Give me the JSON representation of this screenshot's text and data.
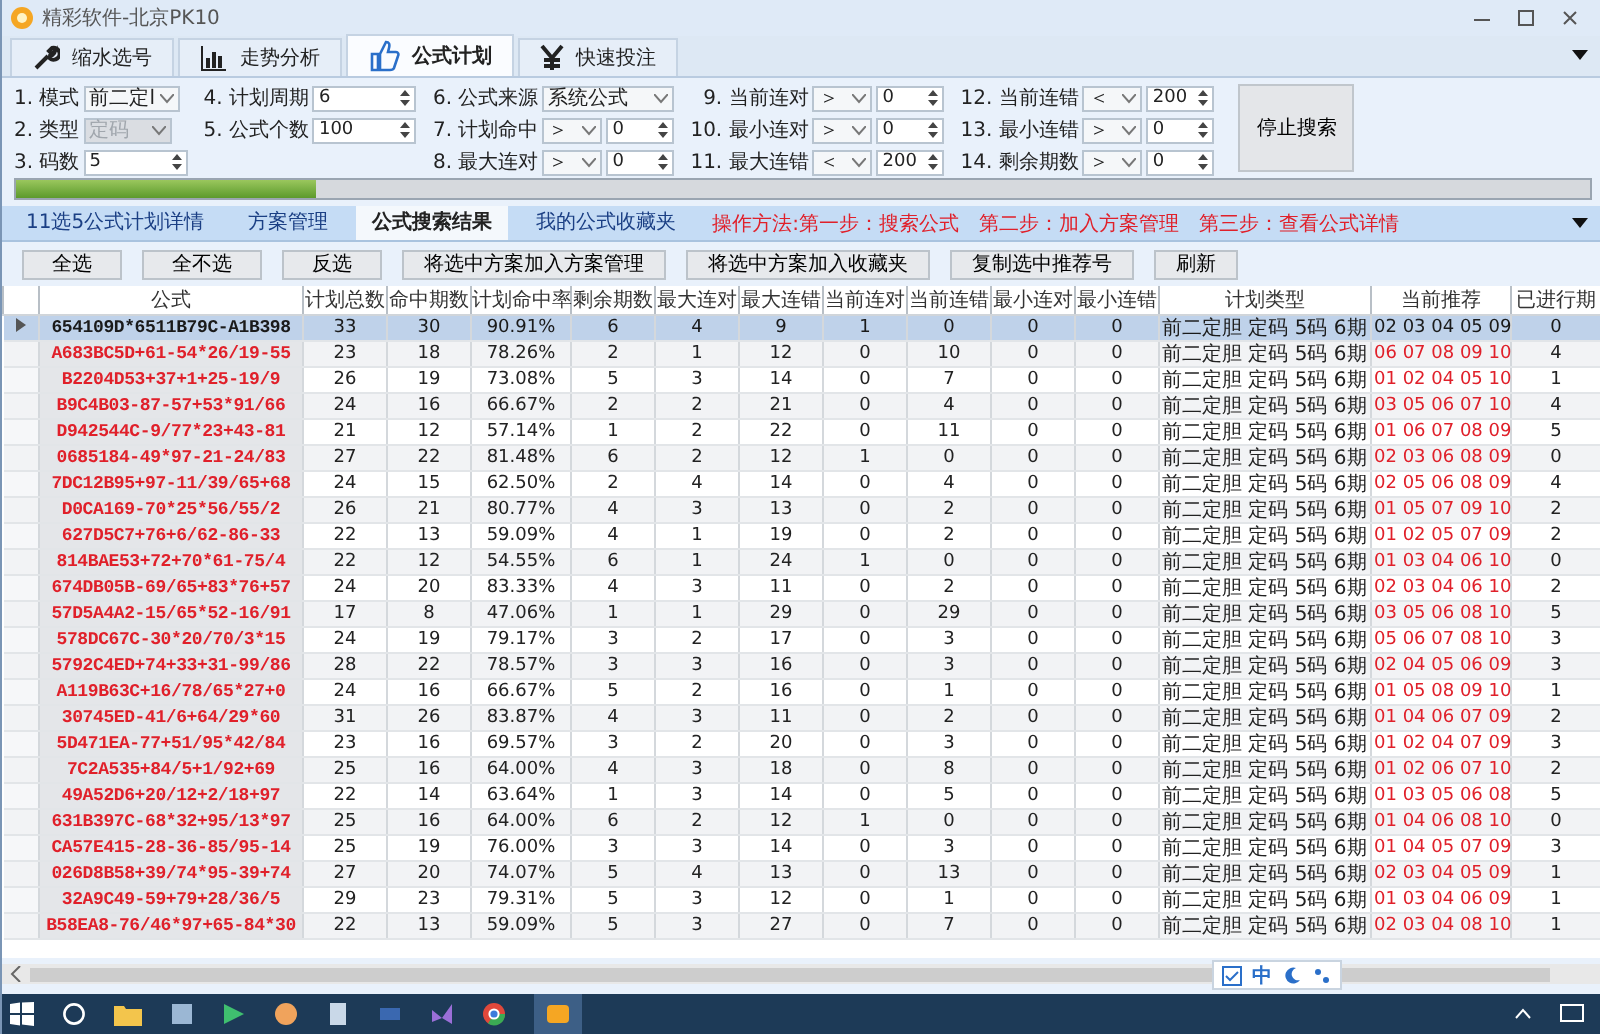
{
  "window": {
    "title": "精彩软件-北京PK10"
  },
  "tabs": [
    {
      "label": "缩水选号",
      "selected": false
    },
    {
      "label": "走势分析",
      "selected": false
    },
    {
      "label": "公式计划",
      "selected": true
    },
    {
      "label": "快速投注",
      "selected": false
    }
  ],
  "filter_columns": [
    [
      {
        "label": "1. 模式",
        "kind": "select",
        "value": "前二定l",
        "disabled": false
      },
      {
        "label": "2. 类型",
        "kind": "select",
        "value": "定码",
        "disabled": true
      },
      {
        "label": "3. 码数",
        "kind": "spin",
        "value": "5"
      }
    ],
    [
      {
        "label": "4. 计划周期",
        "kind": "spin",
        "value": "6"
      },
      {
        "label": "5. 公式个数",
        "kind": "spin",
        "value": "100"
      }
    ],
    [
      {
        "label": "6. 公式来源",
        "kind": "select",
        "value": "系统公式",
        "disabled": false
      },
      {
        "label": "7. 计划命中",
        "kind": "compare",
        "op": "＞",
        "value": "0"
      },
      {
        "label": "8. 最大连对",
        "kind": "compare",
        "op": "＞",
        "value": "0"
      }
    ],
    [
      {
        "label": "9. 当前连对",
        "kind": "compare",
        "op": "＞",
        "value": "0"
      },
      {
        "label": "10. 最小连对",
        "kind": "compare",
        "op": "＞",
        "value": "0"
      },
      {
        "label": "11. 最大连错",
        "kind": "compare",
        "op": "＜",
        "value": "200"
      }
    ],
    [
      {
        "label": "12. 当前连错",
        "kind": "compare",
        "op": "＜",
        "value": "200"
      },
      {
        "label": "13. 最小连错",
        "kind": "compare",
        "op": "＞",
        "value": "0"
      },
      {
        "label": "14. 剩余期数",
        "kind": "compare",
        "op": "＞",
        "value": "0"
      }
    ]
  ],
  "stop_button": "停止搜索",
  "progress": {
    "level": 0.19
  },
  "subtabs": [
    {
      "label": "11选5公式计划详情",
      "selected": false
    },
    {
      "label": "方案管理",
      "selected": false
    },
    {
      "label": "公式搜索结果",
      "selected": true
    },
    {
      "label": "我的公式收藏夹",
      "selected": false
    }
  ],
  "steps": [
    "操作方法:第一步：搜索公式",
    "第二步：加入方案管理",
    "第三步：查看公式详情"
  ],
  "buttons": [
    "全选",
    "全不选",
    "反选",
    "将选中方案加入方案管理",
    "将选中方案加入收藏夹",
    "复制选中推荐号",
    "刷新"
  ],
  "table": {
    "columns": [
      "公式",
      "计划总数",
      "命中期数",
      "计划命中率",
      "剩余期数",
      "最大连对",
      "最大连错",
      "当前连对",
      "当前连错",
      "最小连对",
      "最小连错",
      "计划类型",
      "当前推荐",
      "已进行期"
    ],
    "rows": [
      {
        "selected": true,
        "cells": [
          "654109D*6511B79C-A1B398",
          "33",
          "30",
          "90.91%",
          "6",
          "4",
          "9",
          "1",
          "0",
          "0",
          "0",
          "前二定胆 定码 5码 6期",
          "02 03 04 05 09",
          "0"
        ]
      },
      {
        "selected": false,
        "cells": [
          "A683BC5D+61-54*26/19-55",
          "23",
          "18",
          "78.26%",
          "2",
          "1",
          "12",
          "0",
          "10",
          "0",
          "0",
          "前二定胆 定码 5码 6期",
          "06 07 08 09 10",
          "4"
        ]
      },
      {
        "selected": false,
        "cells": [
          "B2204D53+37+1+25-19/9",
          "26",
          "19",
          "73.08%",
          "5",
          "3",
          "14",
          "0",
          "7",
          "0",
          "0",
          "前二定胆 定码 5码 6期",
          "01 02 04 05 10",
          "1"
        ]
      },
      {
        "selected": false,
        "cells": [
          "B9C4B03-87-57+53*91/66",
          "24",
          "16",
          "66.67%",
          "2",
          "2",
          "21",
          "0",
          "4",
          "0",
          "0",
          "前二定胆 定码 5码 6期",
          "03 05 06 07 10",
          "4"
        ]
      },
      {
        "selected": false,
        "cells": [
          "D942544C-9/77*23+43-81",
          "21",
          "12",
          "57.14%",
          "1",
          "2",
          "22",
          "0",
          "11",
          "0",
          "0",
          "前二定胆 定码 5码 6期",
          "01 06 07 08 09",
          "5"
        ]
      },
      {
        "selected": false,
        "cells": [
          "0685184-49*97-21-24/83",
          "27",
          "22",
          "81.48%",
          "6",
          "2",
          "12",
          "1",
          "0",
          "0",
          "0",
          "前二定胆 定码 5码 6期",
          "02 03 06 08 09",
          "0"
        ]
      },
      {
        "selected": false,
        "cells": [
          "7DC12B95+97-11/39/65+68",
          "24",
          "15",
          "62.50%",
          "2",
          "4",
          "14",
          "0",
          "4",
          "0",
          "0",
          "前二定胆 定码 5码 6期",
          "02 05 06 08 09",
          "4"
        ]
      },
      {
        "selected": false,
        "cells": [
          "D0CA169-70*25*56/55/2",
          "26",
          "21",
          "80.77%",
          "4",
          "3",
          "13",
          "0",
          "2",
          "0",
          "0",
          "前二定胆 定码 5码 6期",
          "01 05 07 09 10",
          "2"
        ]
      },
      {
        "selected": false,
        "cells": [
          "627D5C7+76+6/62-86-33",
          "22",
          "13",
          "59.09%",
          "4",
          "1",
          "19",
          "0",
          "2",
          "0",
          "0",
          "前二定胆 定码 5码 6期",
          "01 02 05 07 09",
          "2"
        ]
      },
      {
        "selected": false,
        "cells": [
          "814BAE53+72+70*61-75/4",
          "22",
          "12",
          "54.55%",
          "6",
          "1",
          "24",
          "1",
          "0",
          "0",
          "0",
          "前二定胆 定码 5码 6期",
          "01 03 04 06 10",
          "0"
        ]
      },
      {
        "selected": false,
        "cells": [
          "674DB05B-69/65+83*76+57",
          "24",
          "20",
          "83.33%",
          "4",
          "3",
          "11",
          "0",
          "2",
          "0",
          "0",
          "前二定胆 定码 5码 6期",
          "02 03 04 06 10",
          "2"
        ]
      },
      {
        "selected": false,
        "cells": [
          "57D5A4A2-15/65*52-16/91",
          "17",
          "8",
          "47.06%",
          "1",
          "1",
          "29",
          "0",
          "29",
          "0",
          "0",
          "前二定胆 定码 5码 6期",
          "03 05 06 08 10",
          "5"
        ]
      },
      {
        "selected": false,
        "cells": [
          "578DC67C-30*20/70/3*15",
          "24",
          "19",
          "79.17%",
          "3",
          "2",
          "17",
          "0",
          "3",
          "0",
          "0",
          "前二定胆 定码 5码 6期",
          "05 06 07 08 10",
          "3"
        ]
      },
      {
        "selected": false,
        "cells": [
          "5792C4ED+74+33+31-99/86",
          "28",
          "22",
          "78.57%",
          "3",
          "3",
          "16",
          "0",
          "3",
          "0",
          "0",
          "前二定胆 定码 5码 6期",
          "02 04 05 06 09",
          "3"
        ]
      },
      {
        "selected": false,
        "cells": [
          "A119B63C+16/78/65*27+0",
          "24",
          "16",
          "66.67%",
          "5",
          "2",
          "16",
          "0",
          "1",
          "0",
          "0",
          "前二定胆 定码 5码 6期",
          "01 05 08 09 10",
          "1"
        ]
      },
      {
        "selected": false,
        "cells": [
          "30745ED-41/6+64/29*60",
          "31",
          "26",
          "83.87%",
          "4",
          "3",
          "11",
          "0",
          "2",
          "0",
          "0",
          "前二定胆 定码 5码 6期",
          "01 04 06 07 09",
          "2"
        ]
      },
      {
        "selected": false,
        "cells": [
          "5D471EA-77+51/95*42/84",
          "23",
          "16",
          "69.57%",
          "3",
          "2",
          "20",
          "0",
          "3",
          "0",
          "0",
          "前二定胆 定码 5码 6期",
          "01 02 04 07 09",
          "3"
        ]
      },
      {
        "selected": false,
        "cells": [
          "7C2A535+84/5+1/92+69",
          "25",
          "16",
          "64.00%",
          "4",
          "3",
          "18",
          "0",
          "8",
          "0",
          "0",
          "前二定胆 定码 5码 6期",
          "01 02 06 07 10",
          "2"
        ]
      },
      {
        "selected": false,
        "cells": [
          "49A52D6+20/12+2/18+97",
          "22",
          "14",
          "63.64%",
          "1",
          "3",
          "14",
          "0",
          "5",
          "0",
          "0",
          "前二定胆 定码 5码 6期",
          "01 03 05 06 08",
          "5"
        ]
      },
      {
        "selected": false,
        "cells": [
          "631B397C-68*32+95/13*97",
          "25",
          "16",
          "64.00%",
          "6",
          "2",
          "12",
          "1",
          "0",
          "0",
          "0",
          "前二定胆 定码 5码 6期",
          "01 04 06 08 10",
          "0"
        ]
      },
      {
        "selected": false,
        "cells": [
          "CA57E415-28-36-85/95-14",
          "25",
          "19",
          "76.00%",
          "3",
          "3",
          "14",
          "0",
          "3",
          "0",
          "0",
          "前二定胆 定码 5码 6期",
          "01 04 05 07 09",
          "3"
        ]
      },
      {
        "selected": false,
        "cells": [
          "026D8B58+39/74*95-39+74",
          "27",
          "20",
          "74.07%",
          "5",
          "4",
          "13",
          "0",
          "13",
          "0",
          "0",
          "前二定胆 定码 5码 6期",
          "02 03 04 05 09",
          "1"
        ]
      },
      {
        "selected": false,
        "cells": [
          "32A9C49-59+79+28/36/5",
          "29",
          "23",
          "79.31%",
          "5",
          "3",
          "12",
          "0",
          "1",
          "0",
          "0",
          "前二定胆 定码 5码 6期",
          "01 03 04 06 09",
          "1"
        ]
      },
      {
        "selected": false,
        "cells": [
          "B58EA8-76/46*97+65-84*30",
          "22",
          "13",
          "59.09%",
          "5",
          "3",
          "27",
          "0",
          "7",
          "0",
          "0",
          "前二定胆 定码 5码 6期",
          "02 03 04 08 10",
          "1"
        ]
      }
    ]
  },
  "ime": {
    "label": "中"
  }
}
